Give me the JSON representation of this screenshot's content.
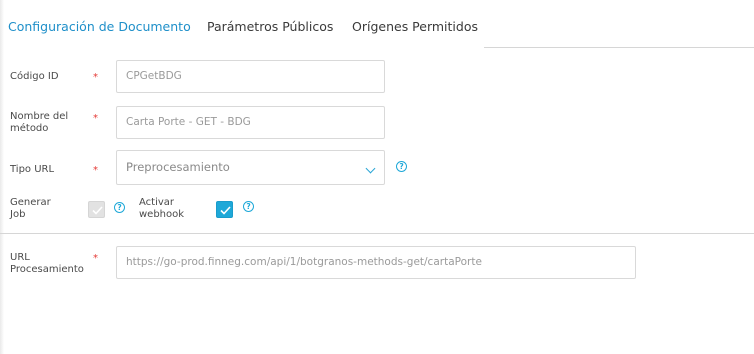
{
  "tabs": [
    {
      "label": "Configuración de Documento",
      "active": true
    },
    {
      "label": "Parámetros Públicos",
      "active": false
    },
    {
      "label": "Orígenes Permitidos",
      "active": false
    }
  ],
  "form": {
    "required_mark": "*",
    "codigo_id": {
      "label": "Código ID",
      "value": "CPGetBDG"
    },
    "nombre_metodo": {
      "label_line1": "Nombre del",
      "label_line2": "método",
      "value": "Carta Porte - GET - BDG"
    },
    "tipo_url": {
      "label": "Tipo URL",
      "selected": "Preprocesamiento"
    },
    "generar_job": {
      "label_line1": "Generar",
      "label_line2": "Job",
      "checked": false
    },
    "activar_webhook": {
      "label_line1": "Activar",
      "label_line2": "webhook",
      "checked": true
    },
    "url_procesamiento": {
      "label_line1": "URL",
      "label_line2": "Procesamiento",
      "value": "https://go-prod.finneg.com/api/1/botgranos-methods-get/cartaPorte"
    },
    "help_glyph": "?"
  },
  "colors": {
    "accent": "#1ea8d8",
    "active_tab": "#1e8fc9",
    "required": "#e53935"
  },
  "icons": {
    "help": "question-circle-icon",
    "dropdown": "chevron-down-icon",
    "check": "checkmark-icon"
  }
}
